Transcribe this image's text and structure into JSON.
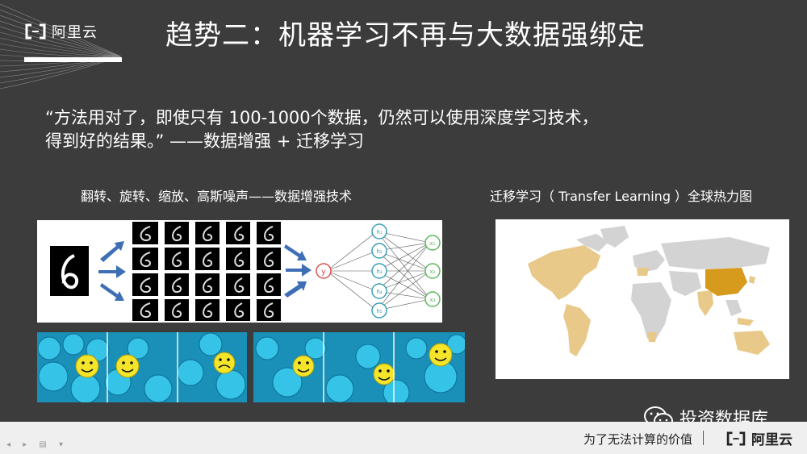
{
  "brand": {
    "name": "阿里云"
  },
  "slide": {
    "title": "趋势二：机器学习不再与大数据强绑定",
    "quote_line1": "“方法用对了，即使只有 100-1000个数据，仍然可以使用深度学习技术，",
    "quote_line2": "得到好的结果。” ——数据增强 + 迁移学习",
    "left_caption": "翻转、旋转、缩放、高斯噪声——数据增强技术",
    "right_caption": "迁移学习（ Transfer Learning ）全球热力图",
    "nn_labels": {
      "input": "y",
      "hidden": [
        "h₁",
        "h₂",
        "h₃",
        "h₄",
        "h₅"
      ],
      "output": [
        "x₁",
        "x₂",
        "x₃"
      ]
    }
  },
  "footer": {
    "tagline": "为了无法计算的价值",
    "brand": "阿里云"
  },
  "watermark": {
    "text": "投资数据库"
  },
  "colors": {
    "background": "#3c3c3c",
    "footer_bg": "#efefef",
    "map_highlight": "#e8c98a",
    "map_strong": "#d69a1c",
    "map_base": "#d3d3d3",
    "arrow_blue": "#3e6fb5"
  }
}
